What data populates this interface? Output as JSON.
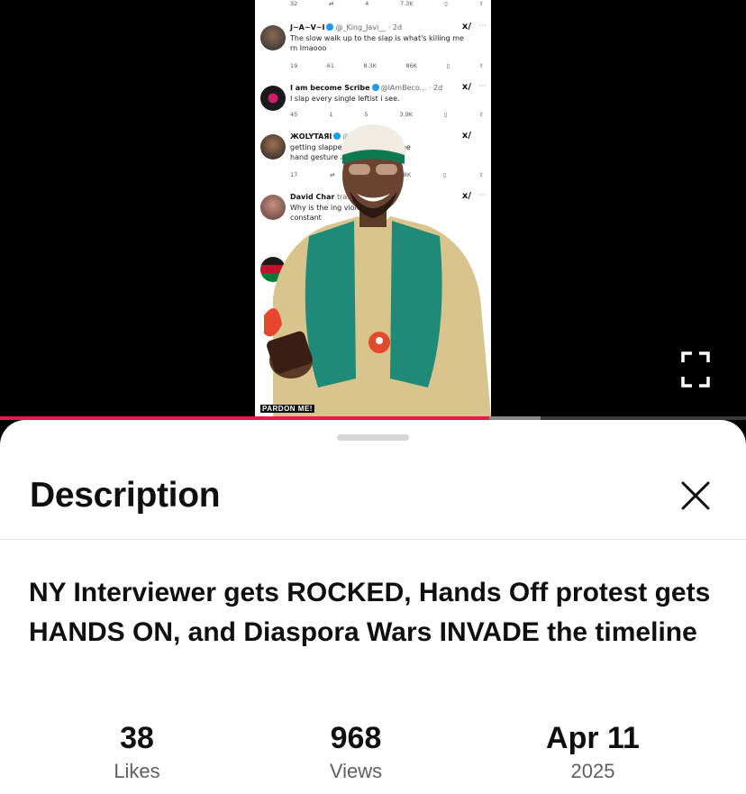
{
  "player": {
    "progress_fraction": 0.656,
    "buffered_fraction": 0.725,
    "accent_color": "#f0154f",
    "fullscreen_icon": "fullscreen-icon",
    "watermark": "PARDON ME!",
    "tweets": [
      {
        "name": "",
        "handle": "",
        "time": "",
        "text": [],
        "metrics": [
          "32",
          "",
          "4",
          "7.3K",
          "",
          ""
        ]
      },
      {
        "name": "J~A~V~I",
        "handle": "@_King_Javi__ · 2d",
        "text": [
          "The slow walk up to the slap is what's killing me",
          "rn lmaooo"
        ],
        "metrics": [
          "19",
          "61",
          "8.3K",
          "86K",
          "",
          ""
        ]
      },
      {
        "name": "I am become Scribe",
        "handle": "@IAmBeco... · 2d",
        "text": [
          "I slap every single leftist i see."
        ],
        "metrics": [
          "45",
          "1",
          "5",
          "3.9K",
          "",
          ""
        ]
      },
      {
        "name": "ЖOLYTAЯI",
        "handle": "@h... · 2d",
        "text": [
          "getting slapped          aving a someone",
          "hand gesture f          so fucking funny"
        ],
        "metrics": [
          "17",
          "",
          "",
          "88K",
          "",
          ""
        ]
      },
      {
        "name": "David Char",
        "handle": "traso... · 2d",
        "text": [
          "Why is the                ing violence",
          "constant"
        ],
        "metrics": [
          "",
          "",
          "",
          "",
          "",
          ""
        ]
      }
    ]
  },
  "description": {
    "heading": "Description",
    "close_icon": "close-icon",
    "video_title": "NY Interviewer gets ROCKED, Hands Off protest gets HANDS ON, and Diaspora Wars INVADE the timeline",
    "stats": [
      {
        "value": "38",
        "label": "Likes"
      },
      {
        "value": "968",
        "label": "Views"
      },
      {
        "value": "Apr 11",
        "label": "2025"
      }
    ]
  }
}
